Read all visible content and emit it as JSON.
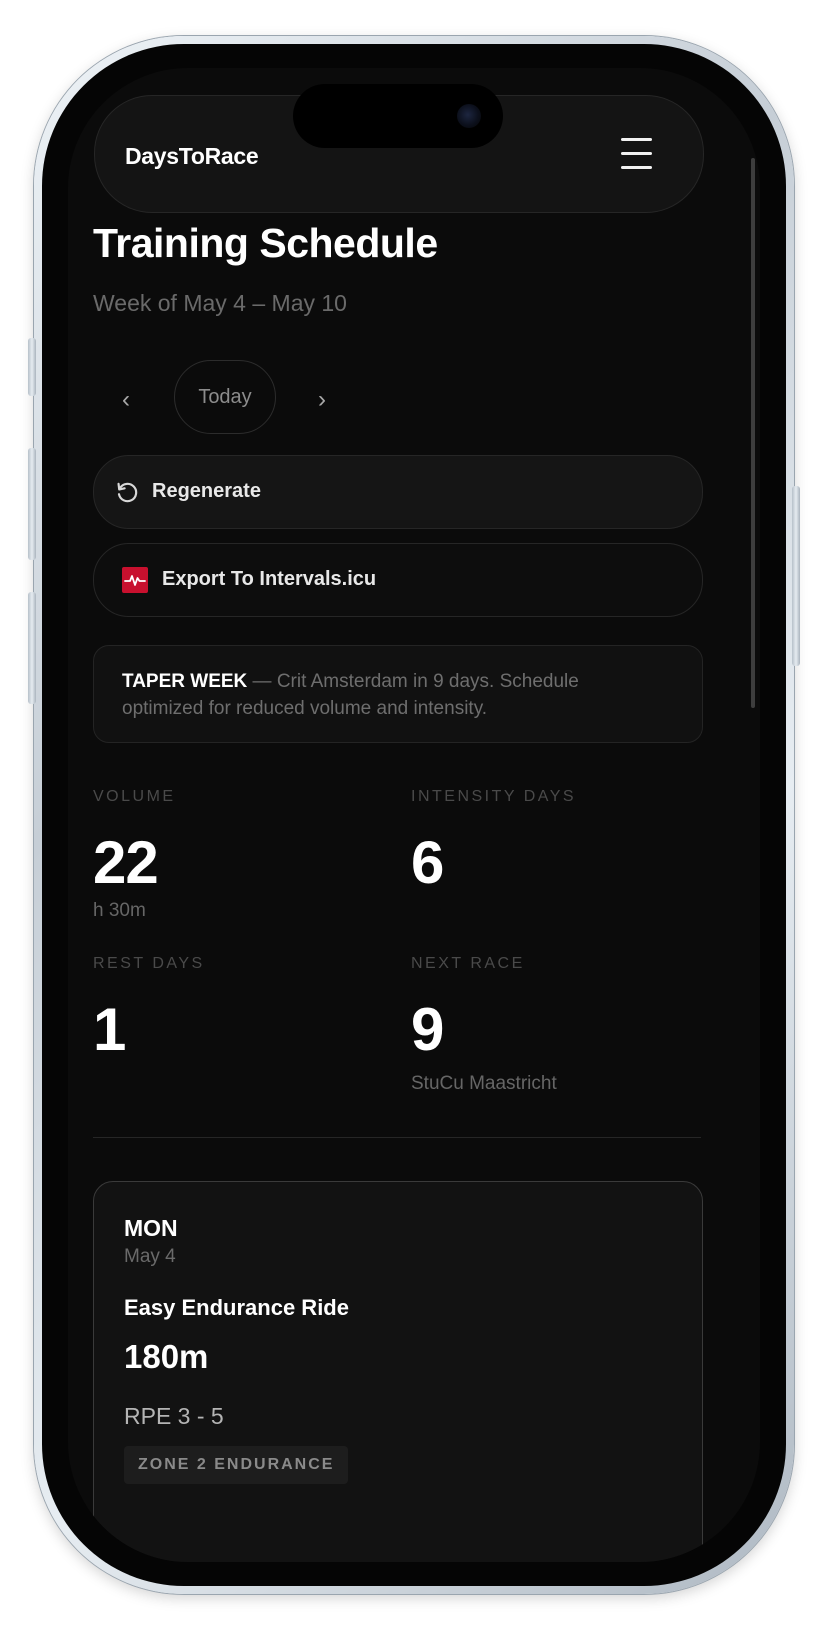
{
  "header": {
    "brand": "DaysToRace"
  },
  "page": {
    "title": "Training Schedule",
    "subtitle": "Week of May 4 – May 10",
    "prev_label": "‹",
    "today_label": "Today",
    "next_label": "›"
  },
  "actions": {
    "regenerate_label": "Regenerate",
    "export_label": "Export To Intervals.icu"
  },
  "notice": {
    "strong": "TAPER WEEK",
    "text": " — Crit Amsterdam in 9 days. Schedule optimized for reduced volume and intensity."
  },
  "stats": {
    "volume": {
      "label": "VOLUME",
      "value": "22",
      "sub": "h 30m"
    },
    "intensity": {
      "label": "INTENSITY DAYS",
      "value": "6"
    },
    "rest": {
      "label": "REST DAYS",
      "value": "1"
    },
    "next_race": {
      "label": "NEXT RACE",
      "value": "9",
      "sub": "StuCu Maastricht"
    }
  },
  "days": [
    {
      "day": "MON",
      "date": "May 4",
      "workout": "Easy Endurance Ride",
      "duration": "180m",
      "rpe": "RPE 3 - 5",
      "zone": "ZONE 2 ENDURANCE"
    }
  ],
  "icons": {
    "menu": "hamburger-menu-icon",
    "regenerate": "refresh-icon",
    "export": "intervals-icu-icon"
  },
  "colors": {
    "background": "#0b0b0b",
    "text": "#ffffff",
    "muted": "#6a6a6a",
    "intervals_brand": "#c8102e"
  }
}
